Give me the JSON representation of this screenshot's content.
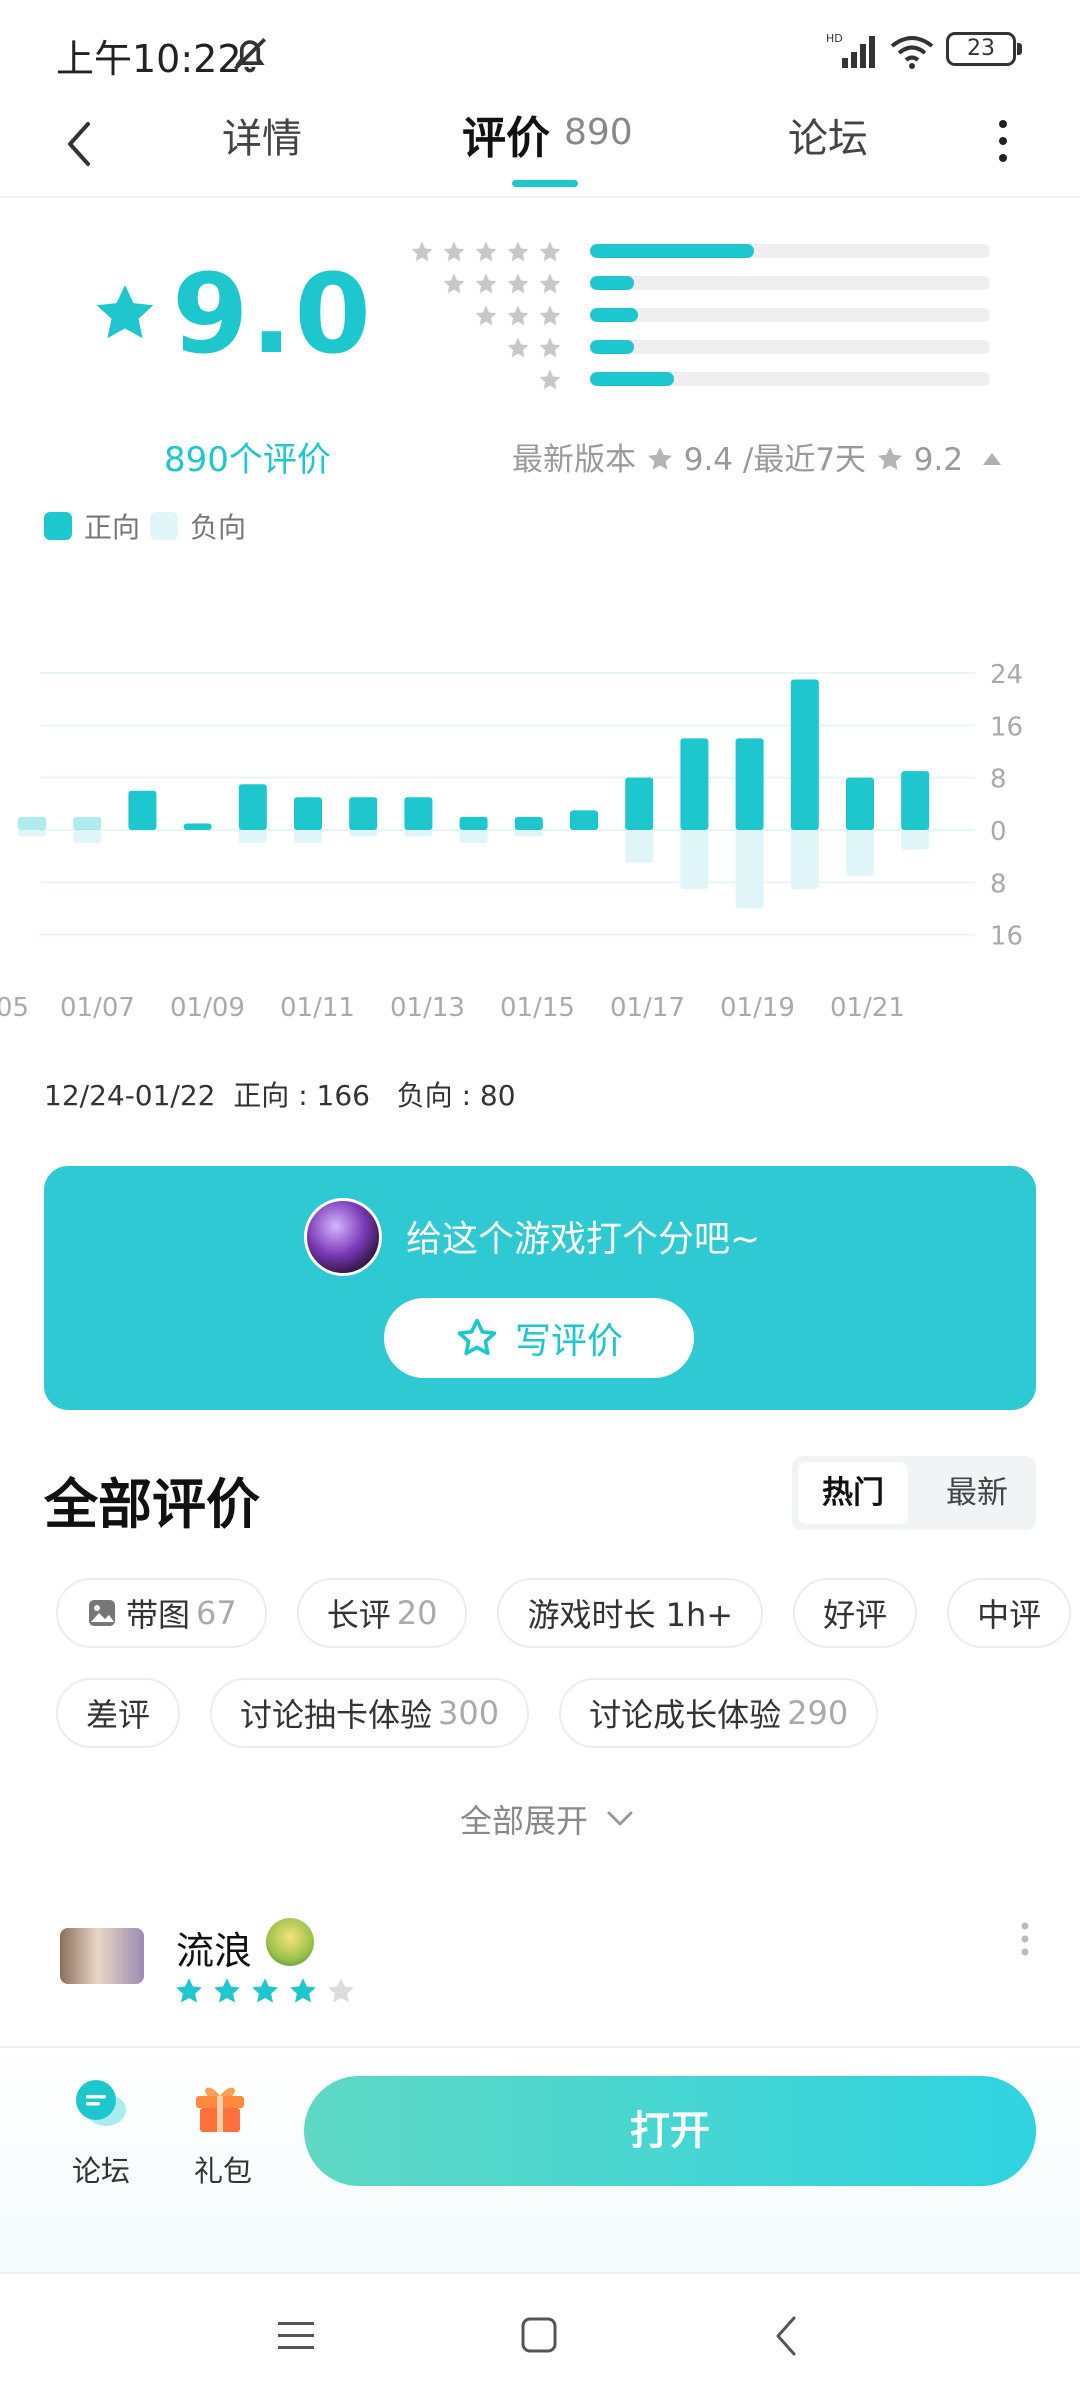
{
  "status_bar": {
    "time": "上午10:22",
    "battery": "23",
    "icons": [
      "bell-off-icon",
      "hd-signal-icon",
      "wifi-icon",
      "battery-icon"
    ]
  },
  "nav": {
    "tabs": [
      {
        "label": "详情"
      },
      {
        "label": "评价",
        "count": "890"
      },
      {
        "label": "论坛"
      }
    ],
    "active_tab": "评价",
    "accent": "#1ec7cd"
  },
  "rating": {
    "score": "9.0",
    "review_count": "890个评价",
    "distribution": [
      {
        "stars": 5,
        "fraction": 0.41
      },
      {
        "stars": 4,
        "fraction": 0.11
      },
      {
        "stars": 3,
        "fraction": 0.12
      },
      {
        "stars": 2,
        "fraction": 0.11
      },
      {
        "stars": 1,
        "fraction": 0.21
      }
    ],
    "latest_version_label": "最新版本",
    "latest_version_score": "9.4",
    "recent_label": "/最近7天",
    "recent_score": "9.2"
  },
  "legend": {
    "positive": "正向",
    "negative": "负向",
    "positive_color": "#1ec7cd",
    "negative_color": "#dff5f7"
  },
  "chart_data": {
    "type": "bar",
    "title": "",
    "xlabel": "",
    "ylabel": "",
    "tick_labels": [
      "05",
      "01/07",
      "01/09",
      "01/11",
      "01/13",
      "01/15",
      "01/17",
      "01/19",
      "01/21"
    ],
    "y_ticks_positive": [
      "24",
      "16",
      "8",
      "0"
    ],
    "y_ticks_negative": [
      "8",
      "16"
    ],
    "ylim": [
      -16,
      24
    ],
    "series": [
      {
        "name": "正向",
        "values": [
          2,
          2,
          6,
          1,
          7,
          5,
          5,
          5,
          2,
          2,
          3,
          8,
          14,
          14,
          23,
          8,
          9
        ]
      },
      {
        "name": "负向",
        "values": [
          -1,
          -2,
          0,
          0,
          -2,
          -2,
          -1,
          -1,
          -2,
          -1,
          0,
          -5,
          -9,
          -12,
          -9,
          -7,
          -3
        ]
      }
    ]
  },
  "chart_summary": "12/24-01/22  正向 : 166   负向 : 80",
  "cta": {
    "prompt": "给这个游戏打个分吧~",
    "write_label": "写评价"
  },
  "all_reviews": {
    "title": "全部评价",
    "sort_hot": "热门",
    "sort_new": "最新",
    "tags": [
      {
        "label": "带图",
        "count": "67",
        "icon": "image-icon"
      },
      {
        "label": "长评",
        "count": "20"
      },
      {
        "label": "游戏时长 1h+",
        "count": ""
      },
      {
        "label": "好评",
        "count": ""
      },
      {
        "label": "中评",
        "count": ""
      },
      {
        "label": "差评",
        "count": ""
      },
      {
        "label": "讨论抽卡体验",
        "count": "300"
      },
      {
        "label": "讨论成长体验",
        "count": "290"
      }
    ],
    "expand_label": "全部展开"
  },
  "review": {
    "user_name": "流浪",
    "stars": 4
  },
  "bottom_bar": {
    "forum_label": "论坛",
    "gift_label": "礼包",
    "open_label": "打开"
  }
}
